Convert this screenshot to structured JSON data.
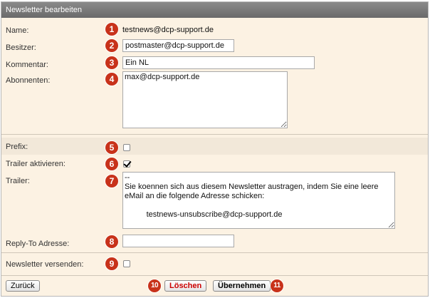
{
  "window": {
    "title": "Newsletter bearbeiten"
  },
  "form": {
    "name": {
      "label": "Name:",
      "value": "testnews@dcp-support.de",
      "badge": "1"
    },
    "owner": {
      "label": "Besitzer:",
      "value": "postmaster@dcp-support.de",
      "badge": "2"
    },
    "comment": {
      "label": "Kommentar:",
      "value": "Ein NL",
      "badge": "3"
    },
    "subscribers": {
      "label": "Abonnenten:",
      "value": "max@dcp-support.de",
      "badge": "4"
    },
    "prefix": {
      "label": "Prefix:",
      "checked": false,
      "badge": "5"
    },
    "trailer_enable": {
      "label": "Trailer aktivieren:",
      "checked": true,
      "badge": "6"
    },
    "trailer": {
      "label": "Trailer:",
      "value": "--\nSie koennen sich aus diesem Newsletter austragen, indem Sie eine leere eMail an die folgende Adresse schicken:\n\n          testnews-unsubscribe@dcp-support.de",
      "badge": "7"
    },
    "reply_to": {
      "label": "Reply-To Adresse:",
      "value": "",
      "badge": "8"
    },
    "send": {
      "label": "Newsletter versenden:",
      "checked": false,
      "badge": "9"
    }
  },
  "footer": {
    "back_label": "Zurück",
    "delete_label": "Löschen",
    "delete_badge": "10",
    "apply_label": "Übernehmen",
    "apply_badge": "11"
  },
  "colors": {
    "panel_bg": "#fcf2e3",
    "titlebar": "#777777",
    "badge": "#c8321a",
    "delete_text": "#cc0000"
  }
}
